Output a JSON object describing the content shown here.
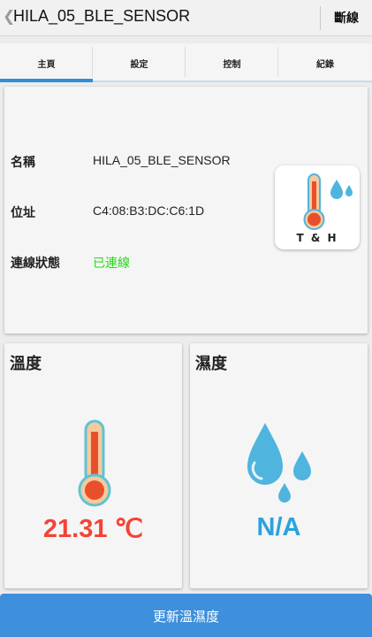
{
  "header": {
    "title": "HILA_05_BLE_SENSOR",
    "disconnect": "斷線"
  },
  "tabs": [
    {
      "label": "主頁",
      "active": true
    },
    {
      "label": "設定",
      "active": false
    },
    {
      "label": "控制",
      "active": false
    },
    {
      "label": "紀錄",
      "active": false
    }
  ],
  "info": {
    "name_label": "名稱",
    "name_value": "HILA_05_BLE_SENSOR",
    "address_label": "位址",
    "address_value": "C4:08:B3:DC:C6:1D",
    "status_label": "連線狀態",
    "status_value": "已連線",
    "status_color": "#21dc14",
    "device_icon": "thermometer-drops-icon",
    "device_icon_text": "T & H"
  },
  "temperature": {
    "title": "溫度",
    "value": "21.31 ℃",
    "color": "#f44336"
  },
  "humidity": {
    "title": "濕度",
    "value": "N/A",
    "color": "#2aa3dd"
  },
  "update_button": "更新溫濕度",
  "colors": {
    "accent": "#3e8fdc",
    "tab_indicator": "#2f8ed4"
  }
}
